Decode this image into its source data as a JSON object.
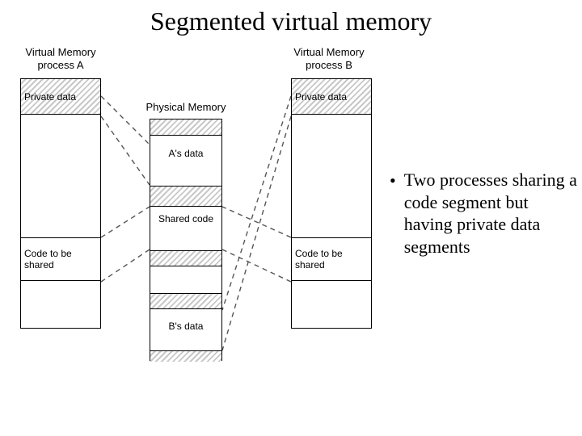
{
  "title": "Segmented virtual memory",
  "labels": {
    "procA": "Virtual Memory\nprocess A",
    "procB": "Virtual Memory\nprocess B",
    "physmem": "Physical Memory"
  },
  "procA": {
    "private_data": "Private data",
    "shared_code": "Code to be shared"
  },
  "procB": {
    "private_data": "Private data",
    "shared_code": "Code to be shared"
  },
  "physmem": {
    "a_data": "A's data",
    "shared_code": "Shared code",
    "b_data": "B's data"
  },
  "bullet": "Two processes sharing a code segment but having private data segments"
}
